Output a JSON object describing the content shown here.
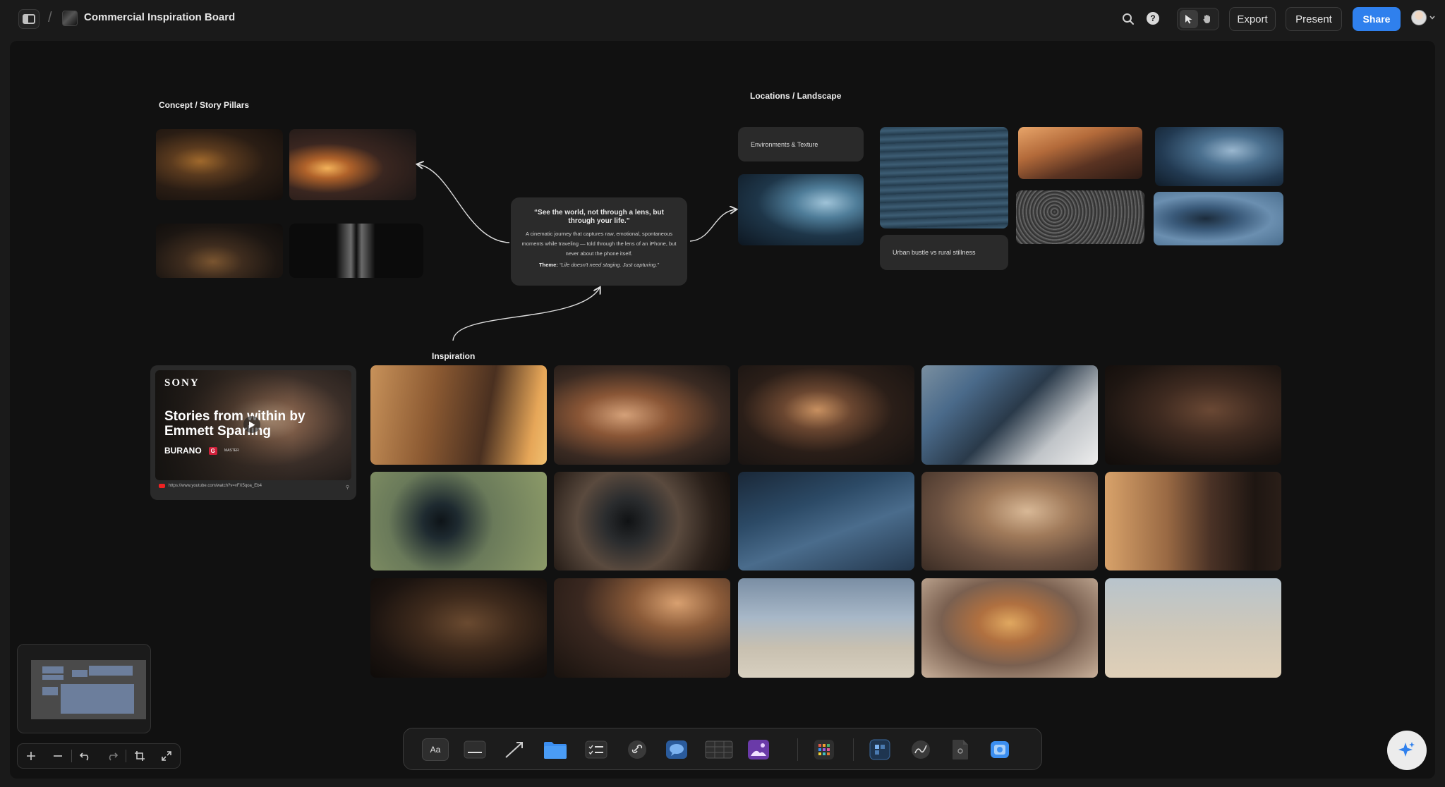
{
  "header": {
    "board_title": "Commercial Inspiration Board",
    "export_label": "Export",
    "present_label": "Present",
    "share_label": "Share",
    "accent_color": "#2f80ed"
  },
  "canvas": {
    "sections": {
      "concept": "Concept / Story Pillars",
      "locations": "Locations / Landscape",
      "inspiration": "Inspiration"
    },
    "quote_card": {
      "quote": "“See the world, not through a lens, but through your life.”",
      "description": "A cinematic journey that captures raw, emotional, spontaneous moments while traveling — told through the lens of an iPhone, but never about the phone itself.",
      "theme_label": "Theme:",
      "theme_text": "“Life doesn't need staging. Just capturing.”"
    },
    "notes": {
      "environments": "Environments & Texture",
      "urban": "Urban bustle vs rural stillness"
    },
    "video_card": {
      "brand": "SONY",
      "title": "Stories from within by Emmett Sparling",
      "product": "BURANO",
      "g_badge": "G",
      "master": "MASTER",
      "url": "https://www.youtube.com/watch?v=vFX5qoa_Eb4"
    }
  },
  "toolbar": {
    "tools": [
      "text-tool-icon",
      "card-tool-icon",
      "arrow-tool-icon",
      "folder-tool-icon",
      "todo-tool-icon",
      "link-tool-icon",
      "comment-tool-icon",
      "table-tool-icon",
      "image-tool-icon",
      "apps-icon",
      "board-icon",
      "sketch-icon",
      "file-icon",
      "upload-icon"
    ],
    "text_tool_label": "Aa"
  }
}
